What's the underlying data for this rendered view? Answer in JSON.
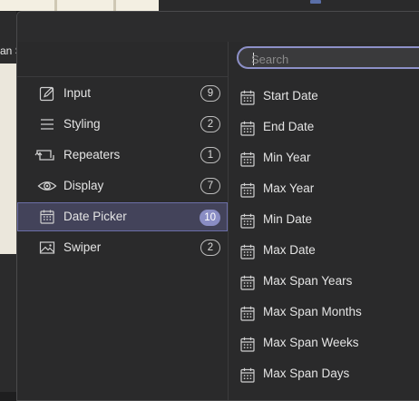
{
  "background": {
    "left_text": "an S"
  },
  "search": {
    "placeholder": "Search",
    "value": ""
  },
  "categories": [
    {
      "label": "Input",
      "count": "9",
      "icon": "pencil-square-icon"
    },
    {
      "label": "Styling",
      "count": "2",
      "icon": "lines-icon"
    },
    {
      "label": "Repeaters",
      "count": "1",
      "icon": "repeat-arrows-icon"
    },
    {
      "label": "Display",
      "count": "7",
      "icon": "eye-icon"
    },
    {
      "label": "Date Picker",
      "count": "10",
      "icon": "calendar-icon",
      "selected": true
    },
    {
      "label": "Swiper",
      "count": "2",
      "icon": "image-icon"
    }
  ],
  "items": [
    {
      "label": "Start Date"
    },
    {
      "label": "End Date"
    },
    {
      "label": "Min Year"
    },
    {
      "label": "Max Year"
    },
    {
      "label": "Min Date"
    },
    {
      "label": "Max Date"
    },
    {
      "label": "Max Span Years"
    },
    {
      "label": "Max Span Months"
    },
    {
      "label": "Max Span Weeks"
    },
    {
      "label": "Max Span Days"
    }
  ],
  "colors": {
    "accent": "#8a8dc4",
    "selected_bg": "#43435a",
    "panel": "#2a2a2b"
  }
}
